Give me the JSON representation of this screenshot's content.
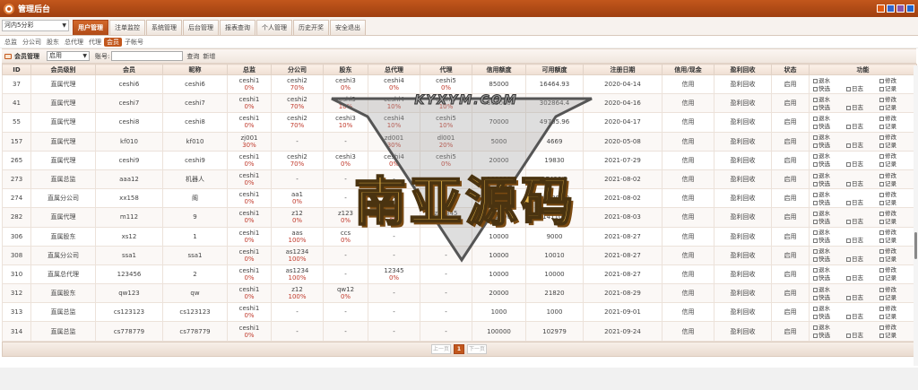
{
  "app": {
    "title": "管理后台",
    "theme_colors": [
      "#e05a10",
      "#3366cc",
      "#8855aa",
      "#2266cc"
    ]
  },
  "game_select": "河内5分彩",
  "menu": [
    {
      "label": "用户管理",
      "active": true
    },
    {
      "label": "注单监控"
    },
    {
      "label": "系统管理"
    },
    {
      "label": "后台管理"
    },
    {
      "label": "报表查询"
    },
    {
      "label": "个人管理"
    },
    {
      "label": "历史开奖"
    },
    {
      "label": "安全退出"
    }
  ],
  "submenu": [
    {
      "label": "总监"
    },
    {
      "label": "分公司"
    },
    {
      "label": "股东"
    },
    {
      "label": "总代理"
    },
    {
      "label": "代理"
    },
    {
      "label": "会员",
      "active": true
    },
    {
      "label": "子帐号"
    }
  ],
  "filter": {
    "title": "会员管理",
    "status_value": "启用",
    "account_label": "账号:",
    "search_label": "查询",
    "add_label": "新增"
  },
  "columns": [
    "ID",
    "会员级别",
    "会员",
    "昵称",
    "总监",
    "分公司",
    "股东",
    "总代理",
    "代理",
    "信用额度",
    "可用额度",
    "注册日期",
    "信用/现金",
    "盈利回收",
    "状态",
    "功能"
  ],
  "actions": [
    "退水",
    "修改",
    "快选",
    "日志",
    "记录"
  ],
  "rows": [
    {
      "id": "37",
      "level": "直属代理",
      "member": "ceshi6",
      "nick": "ceshi6",
      "zj": "ceshi1",
      "zj_p": "0%",
      "fgs": "ceshi2",
      "fgs_p": "70%",
      "gd": "ceshi3",
      "gd_p": "0%",
      "zdl": "ceshi4",
      "zdl_p": "0%",
      "dl": "ceshi5",
      "dl_p": "0%",
      "credit": "85000",
      "avail": "16464.93",
      "date": "2020-04-14",
      "type": "信用",
      "profit": "盈利回收",
      "status": "启用"
    },
    {
      "id": "41",
      "level": "直属代理",
      "member": "ceshi7",
      "nick": "ceshi7",
      "zj": "ceshi1",
      "zj_p": "0%",
      "fgs": "ceshi2",
      "fgs_p": "70%",
      "gd": "ceshi3",
      "gd_p": "10%",
      "zdl": "ceshi4",
      "zdl_p": "10%",
      "dl": "ceshi5",
      "dl_p": "10%",
      "credit": "300000",
      "avail": "302864.4",
      "date": "2020-04-16",
      "type": "信用",
      "profit": "盈利回收",
      "status": "启用"
    },
    {
      "id": "55",
      "level": "直属代理",
      "member": "ceshi8",
      "nick": "ceshi8",
      "zj": "ceshi1",
      "zj_p": "0%",
      "fgs": "ceshi2",
      "fgs_p": "70%",
      "gd": "ceshi3",
      "gd_p": "10%",
      "zdl": "ceshi4",
      "zdl_p": "10%",
      "dl": "ceshi5",
      "dl_p": "10%",
      "credit": "70000",
      "avail": "49705.96",
      "date": "2020-04-17",
      "type": "信用",
      "profit": "盈利回收",
      "status": "启用"
    },
    {
      "id": "157",
      "level": "直属代理",
      "member": "kf010",
      "nick": "kf010",
      "zj": "zj001",
      "zj_p": "30%",
      "fgs": "-",
      "fgs_p": "",
      "gd": "-",
      "gd_p": "",
      "zdl": "zd001",
      "zdl_p": "30%",
      "dl": "dl001",
      "dl_p": "20%",
      "credit": "5000",
      "avail": "4669",
      "date": "2020-05-08",
      "type": "信用",
      "profit": "盈利回收",
      "status": "启用"
    },
    {
      "id": "265",
      "level": "直属代理",
      "member": "ceshi9",
      "nick": "ceshi9",
      "zj": "ceshi1",
      "zj_p": "0%",
      "fgs": "ceshi2",
      "fgs_p": "70%",
      "gd": "ceshi3",
      "gd_p": "0%",
      "zdl": "ceshi4",
      "zdl_p": "0%",
      "dl": "ceshi5",
      "dl_p": "0%",
      "credit": "20000",
      "avail": "19830",
      "date": "2021-07-29",
      "type": "信用",
      "profit": "盈利回收",
      "status": "启用"
    },
    {
      "id": "273",
      "level": "直属总监",
      "member": "aaa12",
      "nick": "机器人",
      "zj": "ceshi1",
      "zj_p": "0%",
      "fgs": "-",
      "fgs_p": "",
      "gd": "-",
      "gd_p": "",
      "zdl": "-",
      "zdl_p": "",
      "dl": "-",
      "dl_p": "",
      "credit": "100000",
      "avail": "97498.5",
      "date": "2021-08-02",
      "type": "信用",
      "profit": "盈利回收",
      "status": "启用"
    },
    {
      "id": "274",
      "level": "直属分公司",
      "member": "xx158",
      "nick": "阁",
      "zj": "ceshi1",
      "zj_p": "0%",
      "fgs": "aa1",
      "fgs_p": "0%",
      "gd": "-",
      "gd_p": "",
      "zdl": "-",
      "zdl_p": "",
      "dl": "-",
      "dl_p": "",
      "credit": "800000",
      "avail": "848881.8",
      "date": "2021-08-02",
      "type": "信用",
      "profit": "盈利回收",
      "status": "启用"
    },
    {
      "id": "282",
      "level": "直属代理",
      "member": "m112",
      "nick": "9",
      "zj": "ceshi1",
      "zj_p": "0%",
      "fgs": "z12",
      "fgs_p": "0%",
      "gd": "z123",
      "gd_p": "0%",
      "zdl": "z1234",
      "zdl_p": "0%",
      "dl": "z12345",
      "dl_p": "70%",
      "credit": "152000",
      "avail": "141100",
      "date": "2021-08-03",
      "type": "信用",
      "profit": "盈利回收",
      "status": "启用"
    },
    {
      "id": "306",
      "level": "直属股东",
      "member": "xs12",
      "nick": "1",
      "zj": "ceshi1",
      "zj_p": "0%",
      "fgs": "aas",
      "fgs_p": "100%",
      "gd": "ccs",
      "gd_p": "0%",
      "zdl": "-",
      "zdl_p": "",
      "dl": "-",
      "dl_p": "",
      "credit": "10000",
      "avail": "9000",
      "date": "2021-08-27",
      "type": "信用",
      "profit": "盈利回收",
      "status": "启用"
    },
    {
      "id": "308",
      "level": "直属分公司",
      "member": "ssa1",
      "nick": "ssa1",
      "zj": "ceshi1",
      "zj_p": "0%",
      "fgs": "as1234",
      "fgs_p": "100%",
      "gd": "-",
      "gd_p": "",
      "zdl": "-",
      "zdl_p": "",
      "dl": "-",
      "dl_p": "",
      "credit": "10000",
      "avail": "10010",
      "date": "2021-08-27",
      "type": "信用",
      "profit": "盈利回收",
      "status": "启用"
    },
    {
      "id": "310",
      "level": "直属总代理",
      "member": "123456",
      "nick": "2",
      "zj": "ceshi1",
      "zj_p": "0%",
      "fgs": "as1234",
      "fgs_p": "100%",
      "gd": "-",
      "gd_p": "",
      "zdl": "12345",
      "zdl_p": "0%",
      "dl": "-",
      "dl_p": "",
      "credit": "10000",
      "avail": "10000",
      "date": "2021-08-27",
      "type": "信用",
      "profit": "盈利回收",
      "status": "启用"
    },
    {
      "id": "312",
      "level": "直属股东",
      "member": "qw123",
      "nick": "qw",
      "zj": "ceshi1",
      "zj_p": "0%",
      "fgs": "z12",
      "fgs_p": "100%",
      "gd": "qw12",
      "gd_p": "0%",
      "zdl": "-",
      "zdl_p": "",
      "dl": "-",
      "dl_p": "",
      "credit": "20000",
      "avail": "21820",
      "date": "2021-08-29",
      "type": "信用",
      "profit": "盈利回收",
      "status": "启用"
    },
    {
      "id": "313",
      "level": "直属总监",
      "member": "cs123123",
      "nick": "cs123123",
      "zj": "ceshi1",
      "zj_p": "0%",
      "fgs": "-",
      "fgs_p": "",
      "gd": "-",
      "gd_p": "",
      "zdl": "-",
      "zdl_p": "",
      "dl": "-",
      "dl_p": "",
      "credit": "1000",
      "avail": "1000",
      "date": "2021-09-01",
      "type": "信用",
      "profit": "盈利回收",
      "status": "启用"
    },
    {
      "id": "314",
      "level": "直属总监",
      "member": "cs778779",
      "nick": "cs778779",
      "zj": "ceshi1",
      "zj_p": "0%",
      "fgs": "-",
      "fgs_p": "",
      "gd": "-",
      "gd_p": "",
      "zdl": "-",
      "zdl_p": "",
      "dl": "-",
      "dl_p": "",
      "credit": "100000",
      "avail": "102979",
      "date": "2021-09-24",
      "type": "信用",
      "profit": "盈利回收",
      "status": "启用"
    }
  ],
  "pager": {
    "prev": "上一页",
    "current": "1",
    "next": "下一页"
  },
  "watermark": {
    "site": "KYXYM.COM",
    "word": "南亚源码"
  }
}
